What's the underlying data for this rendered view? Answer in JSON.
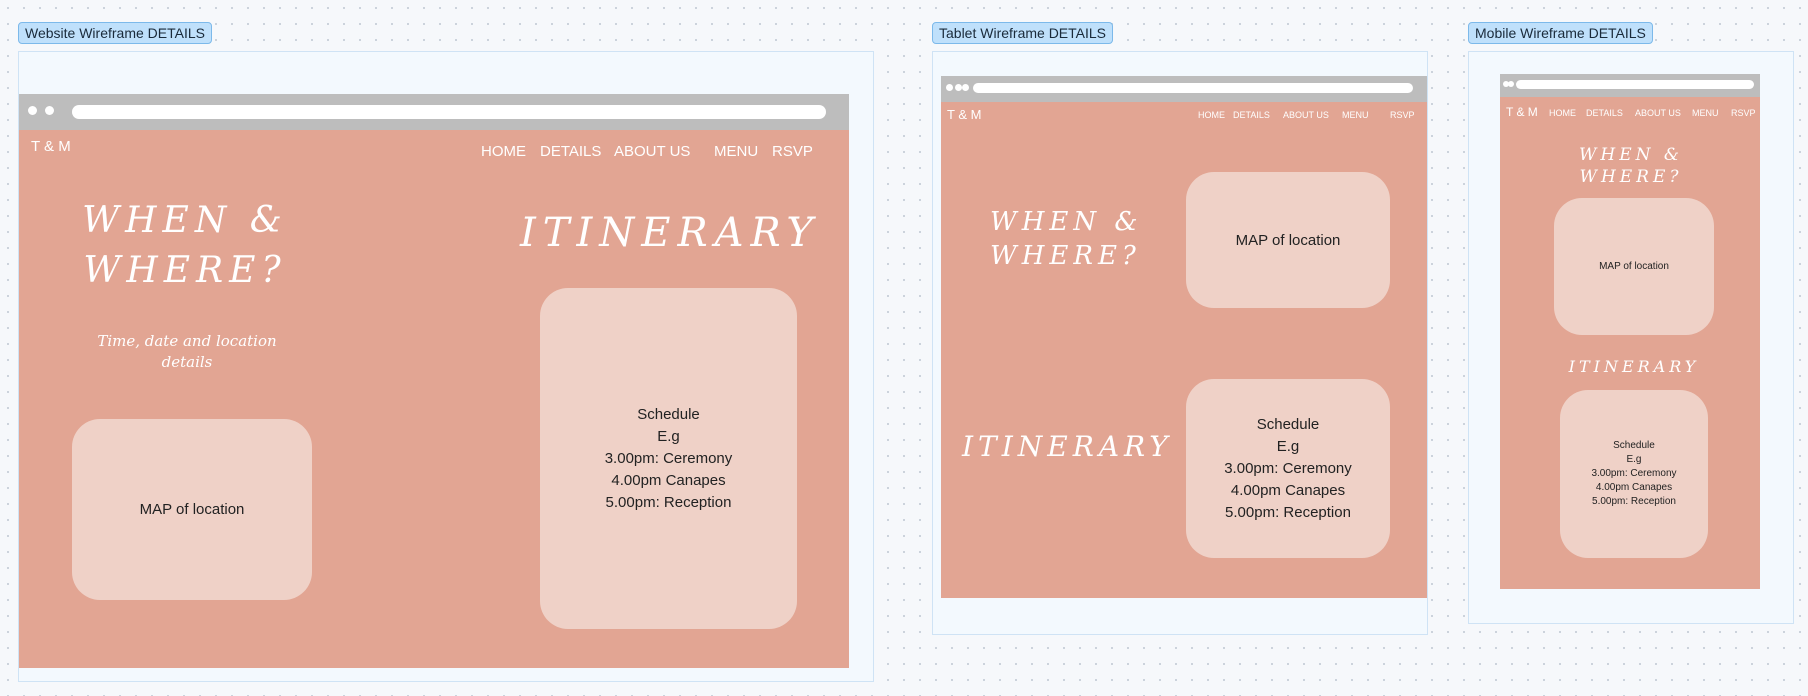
{
  "website": {
    "frame_label": "Website Wireframe DETAILS",
    "brand": "T & M",
    "nav": [
      "HOME",
      "DETAILS",
      "ABOUT US",
      "MENU",
      "RSVP"
    ],
    "when_line1": "WHEN &",
    "when_line2": "WHERE?",
    "subtitle_line1": "Time, date and location",
    "subtitle_line2": "details",
    "itinerary": "ITINERARY",
    "map_label": "MAP of location",
    "schedule": [
      "Schedule",
      "E.g",
      "3.00pm: Ceremony",
      "4.00pm Canapes",
      "5.00pm: Reception"
    ]
  },
  "tablet": {
    "frame_label": "Tablet Wireframe DETAILS",
    "brand": "T & M",
    "nav": [
      "HOME",
      "DETAILS",
      "ABOUT US",
      "MENU",
      "RSVP"
    ],
    "when_line1": "WHEN &",
    "when_line2": "WHERE?",
    "itinerary": "ITINERARY",
    "map_label": "MAP of location",
    "schedule": [
      "Schedule",
      "E.g",
      "3.00pm: Ceremony",
      "4.00pm Canapes",
      "5.00pm: Reception"
    ]
  },
  "mobile": {
    "frame_label": "Mobile Wireframe DETAILS",
    "brand": "T & M",
    "nav": [
      "HOME",
      "DETAILS",
      "ABOUT US",
      "MENU",
      "RSVP"
    ],
    "when_line1": "WHEN &",
    "when_line2": "WHERE?",
    "itinerary": "ITINERARY",
    "map_label": "MAP of location",
    "schedule": [
      "Schedule",
      "E.g",
      "3.00pm: Ceremony",
      "4.00pm Canapes",
      "5.00pm: Reception"
    ]
  },
  "colors": {
    "page_background": "#e2a593",
    "card_background": "#efd1c7",
    "browser_bar": "#bdbdbd",
    "frame_label_background": "#bfe0fb"
  }
}
